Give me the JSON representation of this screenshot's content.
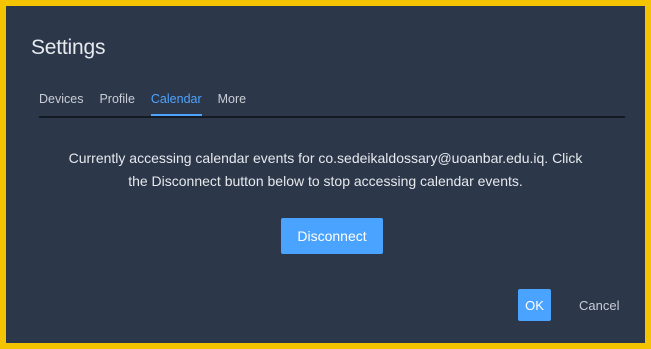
{
  "dialog": {
    "title": "Settings",
    "tabs": [
      {
        "label": "Devices",
        "active": false
      },
      {
        "label": "Profile",
        "active": false
      },
      {
        "label": "Calendar",
        "active": true
      },
      {
        "label": "More",
        "active": false
      }
    ],
    "message_line1": "Currently accessing calendar events for co.sedeikaldossary@uoanbar.edu.iq. Click",
    "message_line2": "the Disconnect button below to stop accessing calendar events.",
    "disconnect_label": "Disconnect",
    "ok_label": "OK",
    "cancel_label": "Cancel"
  },
  "colors": {
    "frame": "#f5c400",
    "background": "#2c3749",
    "accent": "#4aa3ff",
    "text": "#e6e9ee"
  }
}
